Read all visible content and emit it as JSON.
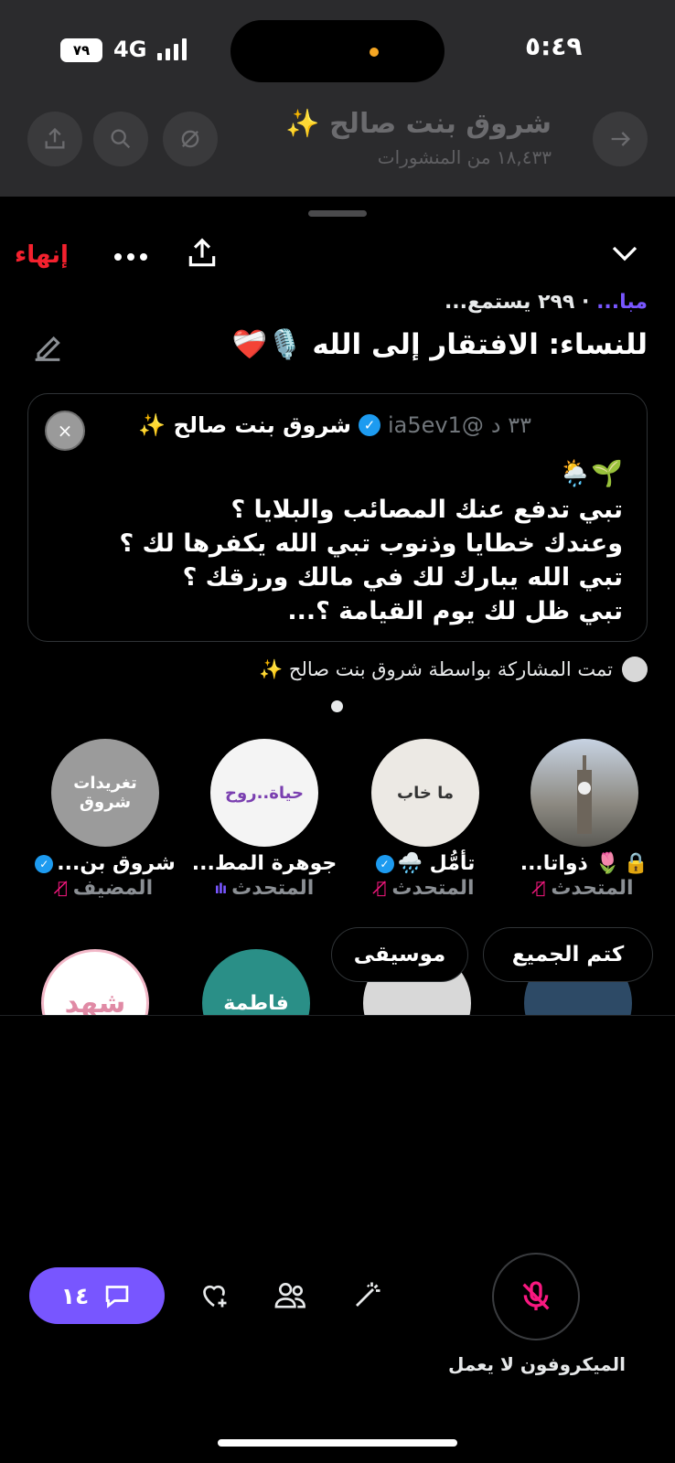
{
  "status_bar": {
    "time": "٥:٤٩",
    "battery": "٧٩",
    "network": "4G",
    "accent_dot": "#f5a623"
  },
  "background_header": {
    "title": "شروق بنت صالح ✨",
    "subtitle": "١٨,٤٣٣ من المنشورات"
  },
  "sheet": {
    "end_label": "إنهاء",
    "meta_live": "مبا...",
    "meta_listeners": " · ٢٩٩ يستمع...",
    "title": "للنساء: الافتقار إلى الله 🎙️❤️‍🩹"
  },
  "tweet": {
    "time": "٣٣ د",
    "handle": "@ia5ev1",
    "name": "شروق بنت صالح ✨",
    "emoji_line": "🌦️🌱",
    "body": [
      "تبي تدفع عنك المصائب والبلايا ؟",
      "وعندك خطايا وذنوب تبي الله يكفرها لك ؟",
      "تبي الله يبارك لك في مالك ورزقك ؟",
      "تبي ظل لك يوم القيامة ؟..."
    ]
  },
  "shared_by": "تمت المشاركة بواسطة شروق بنت صالح ✨",
  "participants": [
    {
      "name": "شروق بن...",
      "role": "المضيف",
      "avatar_text": "تغريدات شروق",
      "verified": true
    },
    {
      "name": "جوهرة المط...",
      "role": "المتحدث",
      "avatar_text": "حياة..روح",
      "speaking": true
    },
    {
      "name": "تأمُّل 🌧️",
      "role": "المتحدث",
      "avatar_text": "ما خاب",
      "verified": true
    },
    {
      "name": "🌷 ذواتا...",
      "role": "المتحدث",
      "avatar_text": "",
      "locked": true
    }
  ],
  "second_row": {
    "avatar_a": "شهد",
    "avatar_b": "فاطمة"
  },
  "pills": {
    "mute_all": "كتم الجميع",
    "music": "موسيقى"
  },
  "bottom": {
    "chat_count": "١٤",
    "mic_label": "الميكروفون لا يعمل"
  },
  "colors": {
    "brand_purple": "#7856ff",
    "mute_pink": "#f91880",
    "end_red": "#f4212e",
    "verified_blue": "#1d9bf0"
  }
}
